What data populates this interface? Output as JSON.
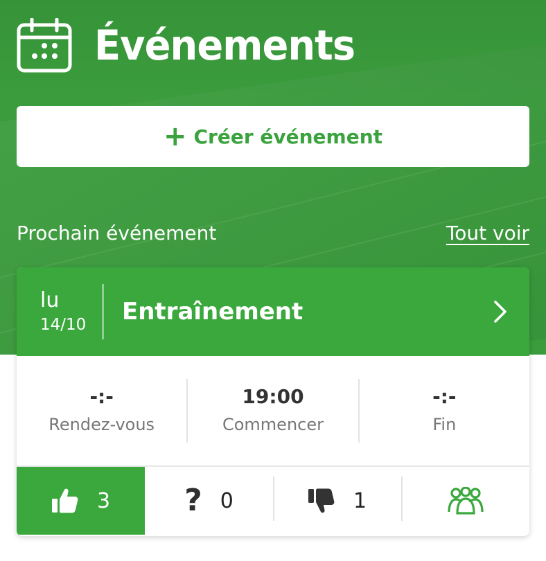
{
  "header": {
    "title": "Événements",
    "icon": "calendar-icon"
  },
  "create_button": {
    "label": "Créer événement",
    "icon": "plus-icon"
  },
  "section": {
    "title": "Prochain événement",
    "see_all": "Tout voir"
  },
  "event": {
    "day": "lu",
    "date": "14/10",
    "name": "Entraînement",
    "times": [
      {
        "value": "-:-",
        "label": "Rendez-vous"
      },
      {
        "value": "19:00",
        "label": "Commencer"
      },
      {
        "value": "-:-",
        "label": "Fin"
      }
    ],
    "rsvp": {
      "yes": "3",
      "maybe": "0",
      "no": "1"
    }
  },
  "colors": {
    "brand_green": "#3aa83d",
    "hero_green": "#3a9c3c"
  }
}
